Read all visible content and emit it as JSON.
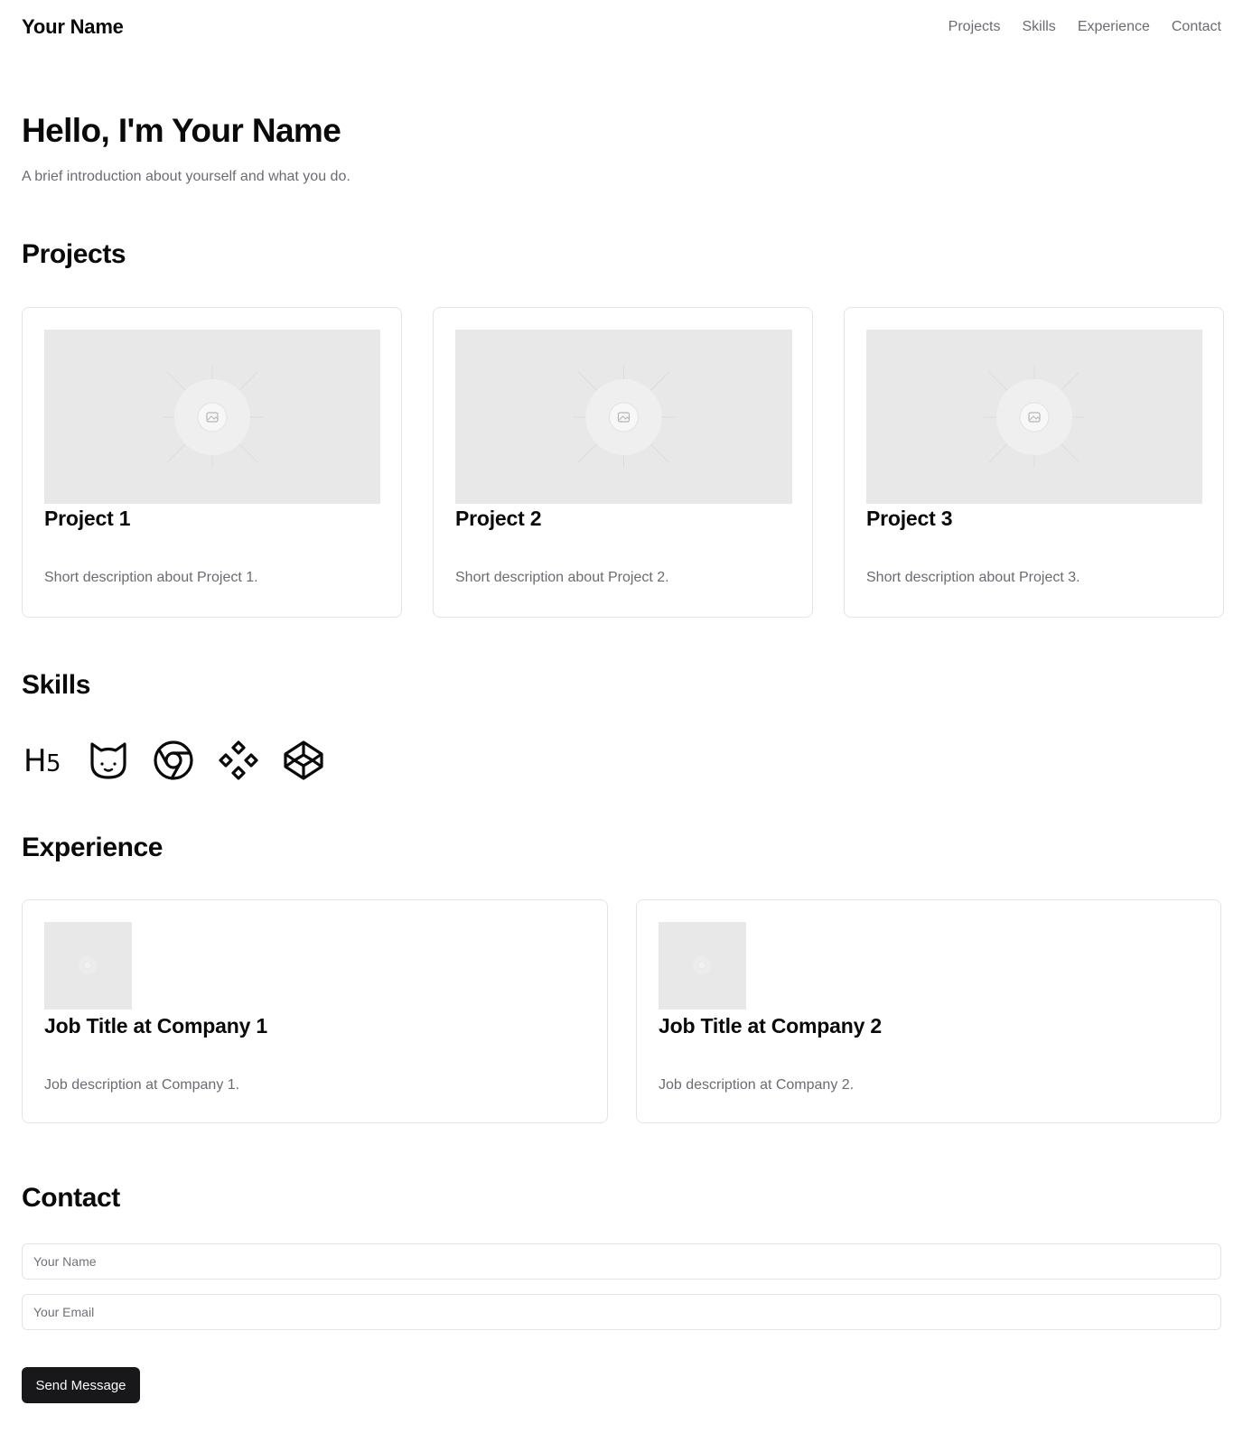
{
  "header": {
    "brand": "Your Name",
    "nav": [
      "Projects",
      "Skills",
      "Experience",
      "Contact"
    ]
  },
  "hero": {
    "title": "Hello, I'm Your Name",
    "subtitle": "A brief introduction about yourself and what you do."
  },
  "projects": {
    "title": "Projects",
    "items": [
      {
        "title": "Project 1",
        "description": "Short description about Project 1.",
        "image_icon": "image-placeholder-icon"
      },
      {
        "title": "Project 2",
        "description": "Short description about Project 2.",
        "image_icon": "image-placeholder-icon"
      },
      {
        "title": "Project 3",
        "description": "Short description about Project 3.",
        "image_icon": "image-placeholder-icon"
      }
    ]
  },
  "skills": {
    "title": "Skills",
    "icons": [
      "html5-icon",
      "cat-icon",
      "chrome-icon",
      "diamonds-icon",
      "codepen-icon"
    ]
  },
  "experience": {
    "title": "Experience",
    "items": [
      {
        "title": "Job Title at Company 1",
        "description": "Job description at Company 1."
      },
      {
        "title": "Job Title at Company 2",
        "description": "Job description at Company 2."
      }
    ]
  },
  "contact": {
    "title": "Contact",
    "name_placeholder": "Your Name",
    "email_placeholder": "Your Email",
    "send_label": "Send Message"
  },
  "colors": {
    "text": "#0a0a0a",
    "muted": "#6b6b73",
    "border": "#e4e4e7",
    "placeholder_bg": "#e8e8e8",
    "button_bg": "#18181b"
  }
}
